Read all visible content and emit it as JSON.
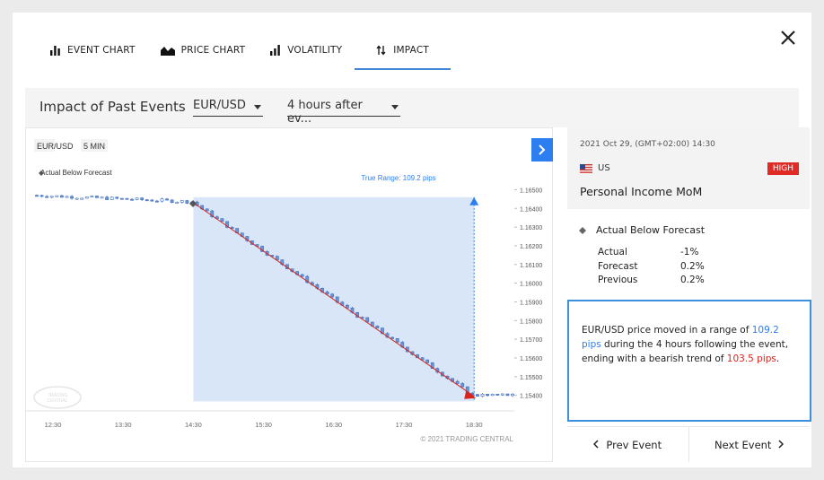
{
  "tabs": [
    {
      "label": "EVENT CHART",
      "icon": "bar-chart-icon"
    },
    {
      "label": "PRICE CHART",
      "icon": "area-chart-icon"
    },
    {
      "label": "VOLATILITY",
      "icon": "volatility-icon"
    },
    {
      "label": "IMPACT",
      "icon": "impact-arrows-icon"
    }
  ],
  "active_tab": "IMPACT",
  "filter": {
    "title": "Impact of Past Events",
    "pair_value": "EUR/USD",
    "window_value": "4 hours after ev..."
  },
  "chart": {
    "symbol": "EUR/USD",
    "timeframe": "5 MIN",
    "legend_text": "Actual Below Forecast",
    "range_label": "True Range: 109.2 pips",
    "copyright": "© 2021 TRADING CENTRAL",
    "watermark_line1": "TRADING",
    "watermark_line2": "CENTRAL"
  },
  "chart_data": {
    "type": "candlestick",
    "x_ticks": [
      "12:30",
      "13:30",
      "14:30",
      "15:30",
      "16:30",
      "17:30",
      "18:30"
    ],
    "y_ticks": [
      "1.16500",
      "1.16400",
      "1.16300",
      "1.16200",
      "1.16100",
      "1.16000",
      "1.15900",
      "1.15800",
      "1.15700",
      "1.15600",
      "1.15500",
      "1.15400"
    ],
    "ylim": [
      1.1536,
      1.1655
    ],
    "event_time": "14:30",
    "window_end": "18:30",
    "trend_start": 1.1643,
    "trend_end": 1.15395,
    "range_high": 1.1646,
    "range_low": 1.15368,
    "true_range_pips": 109.2
  },
  "event": {
    "datetime": "2021 Oct 29, (GMT+02:00) 14:30",
    "country": "US",
    "impact": "HIGH",
    "name": "Personal Income MoM",
    "result_label": "Actual Below Forecast",
    "actual_label": "Actual",
    "actual_value": "-1%",
    "forecast_label": "Forecast",
    "forecast_value": "0.2%",
    "previous_label": "Previous",
    "previous_value": "0.2%"
  },
  "summary": {
    "part1": "EUR/USD price moved in a range of ",
    "range_value": "109.2 pips",
    "part2": " during the 4 hours following the event, ending with a bearish trend of ",
    "trend_value": "103.5 pips",
    "part3": "."
  },
  "nav": {
    "prev_label": "Prev Event",
    "next_label": "Next Event"
  },
  "colors": {
    "accent": "#2d7ef0",
    "bearish": "#d9241d",
    "candle": "#6e95d3",
    "range_fill": "#d9e6f7",
    "high_badge": "#e02a25"
  }
}
